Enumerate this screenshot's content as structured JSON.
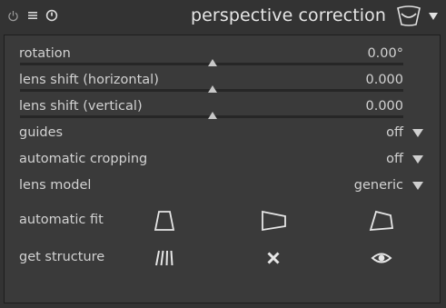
{
  "header": {
    "title": "perspective correction",
    "icons": [
      "power-icon",
      "presets-icon",
      "reset-icon",
      "module-perspective-icon",
      "collapse-arrow-icon"
    ]
  },
  "sliders": [
    {
      "label": "rotation",
      "value": "0.00°",
      "level": 0.5
    },
    {
      "label": "lens shift (horizontal)",
      "value": "0.000",
      "level": 0.5
    },
    {
      "label": "lens shift (vertical)",
      "value": "0.000",
      "level": 0.5
    }
  ],
  "combos": [
    {
      "label": "guides",
      "value": "off"
    },
    {
      "label": "automatic cropping",
      "value": "off"
    },
    {
      "label": "lens model",
      "value": "generic"
    }
  ],
  "automatic_fit": {
    "label": "automatic fit",
    "buttons": [
      "fit-vertical-icon",
      "fit-horizontal-icon",
      "fit-both-icon"
    ]
  },
  "get_structure": {
    "label": "get structure",
    "buttons": [
      "structure-lines-icon",
      "clear-structure-icon",
      "display-structure-icon"
    ]
  },
  "colors": {
    "background": "#333333",
    "panel": "#3a3a3a",
    "text": "#d2d2d2",
    "track": "#262626"
  }
}
